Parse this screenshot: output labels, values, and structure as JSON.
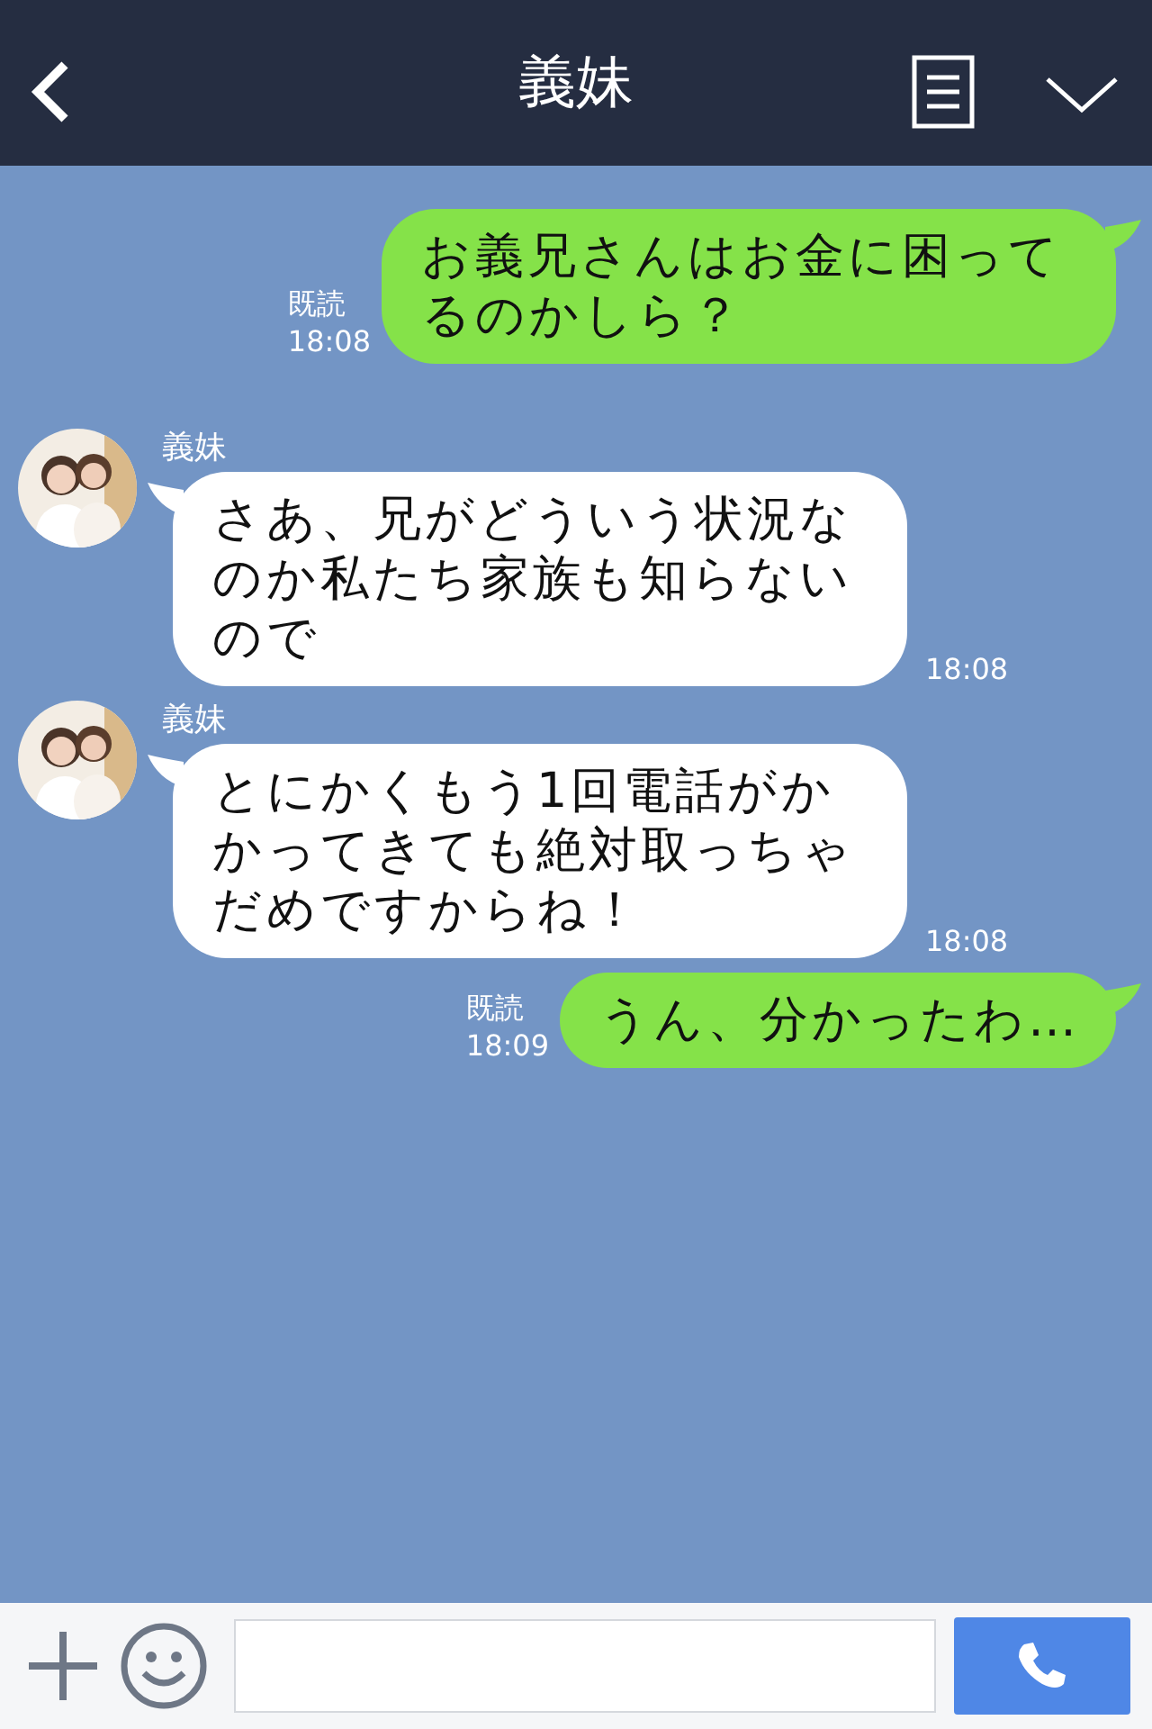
{
  "header": {
    "title": "義妹"
  },
  "messages": [
    {
      "kind": "sent",
      "text": "お義兄さんはお金に困ってるのかしら？",
      "read": "既読",
      "time": "18:08"
    },
    {
      "kind": "received",
      "name": "義妹",
      "text": "さあ、兄がどういう状況なのか私たち家族も知らないので",
      "time": "18:08"
    },
    {
      "kind": "received",
      "name": "義妹",
      "text": "とにかくもう1回電話がかかってきても絶対取っちゃだめですからね！",
      "time": "18:08"
    },
    {
      "kind": "sent",
      "text": "うん、分かったわ…",
      "read": "既読",
      "time": "18:09"
    }
  ]
}
